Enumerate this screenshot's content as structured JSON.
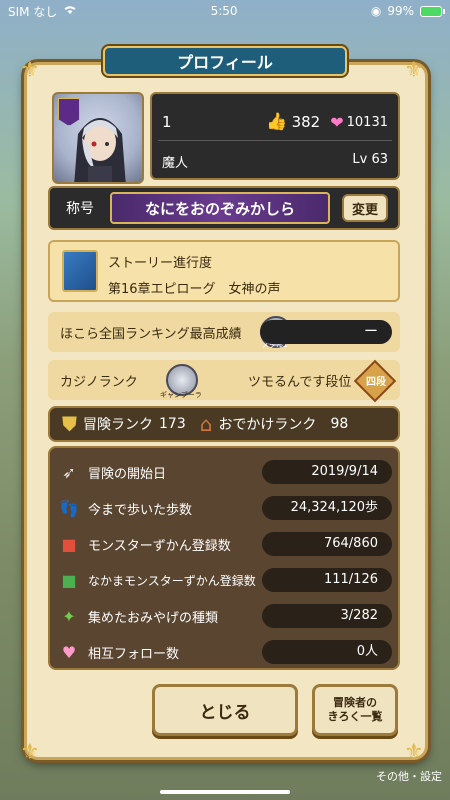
{
  "status_bar": {
    "carrier": "SIM なし",
    "time": "5:50",
    "battery": "99%"
  },
  "header": {
    "title": "プロフィール"
  },
  "profile": {
    "name": "1",
    "likes": "382",
    "hearts": "10131",
    "job": "魔人",
    "level": "Lv 63"
  },
  "title_row": {
    "label": "称号",
    "title_text": "なにをおのぞみかしら",
    "change_label": "変更"
  },
  "story": {
    "heading": "ストーリー進行度",
    "chapter": "第16章エピローグ　女神の声"
  },
  "hokora": {
    "label": "ほこら全国ランキング最高成績",
    "value": "ー",
    "medal_text": "メタル1"
  },
  "casino": {
    "label": "カジノランク",
    "medal_text": "ギャンブーラ",
    "rank_name": "ツモるんです段位",
    "badge_text": "四段"
  },
  "ranks": {
    "adventure_label": "冒険ランク",
    "adventure_value": "173",
    "outing_label": "おでかけランク",
    "outing_value": "98"
  },
  "stats": [
    {
      "icon": "wing-icon",
      "label": "冒険の開始日",
      "value": "2019/9/14"
    },
    {
      "icon": "footprint-icon",
      "label": "今まで歩いた歩数",
      "value": "24,324,120歩"
    },
    {
      "icon": "monster-book-icon",
      "label": "モンスターずかん登録数",
      "value": "764/860"
    },
    {
      "icon": "ally-book-icon",
      "label": "なかまモンスターずかん登録数",
      "value": "111/126"
    },
    {
      "icon": "souvenir-icon",
      "label": "集めたおみやげの種類",
      "value": "3/282"
    },
    {
      "icon": "handshake-icon",
      "label": "相互フォロー数",
      "value": "0人"
    }
  ],
  "buttons": {
    "close": "とじる",
    "record_line1": "冒険者の",
    "record_line2": "きろく一覧",
    "other": "その他・設定"
  }
}
